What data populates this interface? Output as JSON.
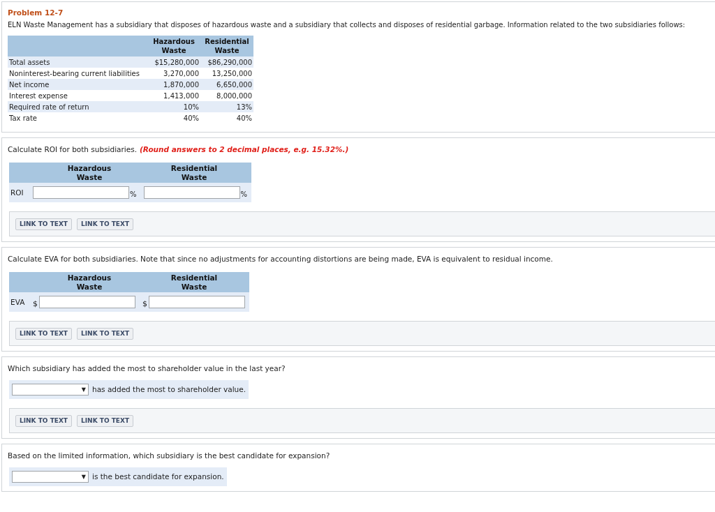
{
  "problem": {
    "title": "Problem 12-7",
    "intro": "ELN Waste Management has a subsidiary that disposes of hazardous waste and a subsidiary that collects and disposes of residential garbage. Information related to the two subsidiaries follows:",
    "table": {
      "columns": [
        "Hazardous Waste",
        "Residential Waste"
      ],
      "rows": [
        {
          "label": "Total assets",
          "values": [
            "$15,280,000",
            "$86,290,000"
          ]
        },
        {
          "label": "Noninterest-bearing current liabilities",
          "values": [
            "3,270,000",
            "13,250,000"
          ]
        },
        {
          "label": "Net income",
          "values": [
            "1,870,000",
            "6,650,000"
          ]
        },
        {
          "label": "Interest expense",
          "values": [
            "1,413,000",
            "8,000,000"
          ]
        },
        {
          "label": "Required rate of return",
          "values": [
            "10%",
            "13%"
          ]
        },
        {
          "label": "Tax rate",
          "values": [
            "40%",
            "40%"
          ]
        }
      ]
    }
  },
  "parts": [
    {
      "kind": "inputs",
      "prompt": "Calculate ROI for both subsidiaries.",
      "note": "(Round answers to 2 decimal places, e.g. 15.32%.)",
      "columns": [
        "Hazardous Waste",
        "Residential Waste"
      ],
      "row_label": "ROI",
      "fields": [
        {
          "suffix": "%"
        },
        {
          "suffix": "%"
        }
      ],
      "links": [
        "LINK TO TEXT",
        "LINK TO TEXT"
      ]
    },
    {
      "kind": "inputs",
      "prompt": "Calculate EVA for both subsidiaries. Note that since no adjustments for accounting distortions are being made, EVA is equivalent to residual income.",
      "columns": [
        "Hazardous Waste",
        "Residential Waste"
      ],
      "row_label": "EVA",
      "fields": [
        {
          "prefix": "$"
        },
        {
          "prefix": "$"
        }
      ],
      "links": [
        "LINK TO TEXT",
        "LINK TO TEXT"
      ]
    },
    {
      "kind": "dropdown",
      "prompt": "Which subsidiary has added the most to shareholder value in the last year?",
      "caret": "▼",
      "suffix": "has added the most to shareholder value.",
      "links": [
        "LINK TO TEXT",
        "LINK TO TEXT"
      ]
    },
    {
      "kind": "dropdown",
      "prompt": "Based on the limited information, which subsidiary is the best candidate for expansion?",
      "caret": "▼",
      "suffix": "is the best candidate for expansion."
    }
  ]
}
